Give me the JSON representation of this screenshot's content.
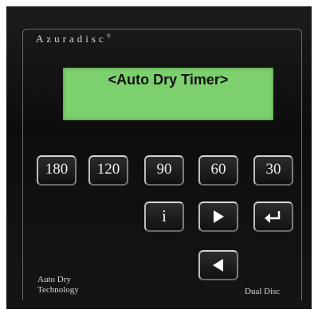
{
  "brand": {
    "name": "Azuradisc",
    "mark": "®"
  },
  "display": {
    "text": "<Auto Dry Timer>",
    "color": "#7cd06e"
  },
  "keys": {
    "k180": "180",
    "k120": "120",
    "k90": "90",
    "k60": "60",
    "k30": "30",
    "info": "i"
  },
  "icons": {
    "right": "right-arrow-icon",
    "enter": "enter-icon",
    "left": "left-arrow-icon"
  },
  "labels": {
    "left_line1": "Auto Dry",
    "left_line2": "Technology",
    "right": "Dual Disc"
  }
}
